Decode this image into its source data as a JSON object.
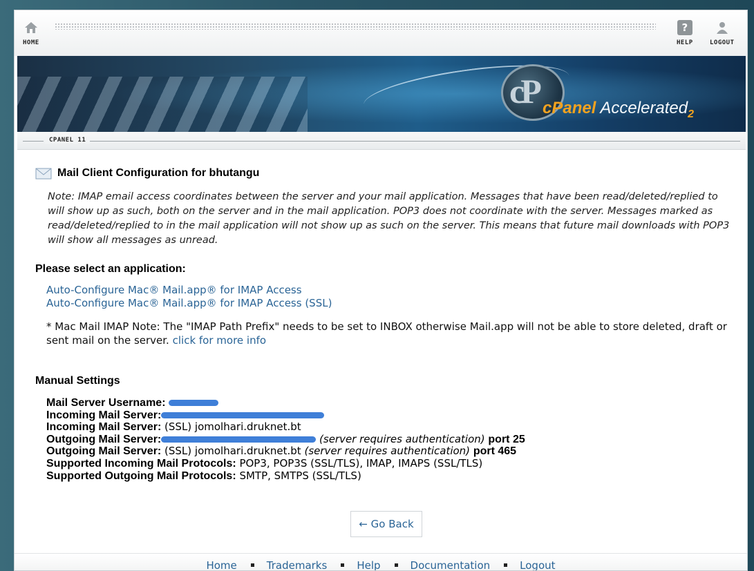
{
  "nav": {
    "home_label": "HOME",
    "help_label": "HELP",
    "logout_label": "LOGOUT"
  },
  "banner": {
    "logo_cpanel": "cPanel",
    "logo_accelerated": "Accelerated",
    "logo_version": "2"
  },
  "breadcrumb": {
    "label": "CPANEL 11"
  },
  "page": {
    "title": "Mail Client Configuration for bhutangu",
    "note": "Note: IMAP email access coordinates between the server and your mail application. Messages that have been read/deleted/replied to will show up as such, both on the server and in the mail application. POP3 does not coordinate with the server. Messages marked as read/deleted/replied to in the mail application will not show up as such on the server. This means that future mail downloads with POP3 will show all messages as unread."
  },
  "apps": {
    "heading": "Please select an application:",
    "links": [
      "Auto-Configure Mac® Mail.app® for IMAP Access",
      "Auto-Configure Mac® Mail.app® for IMAP Access (SSL)"
    ],
    "mac_note": "* Mac Mail IMAP Note: The \"IMAP Path Prefix\" needs to be set to INBOX otherwise Mail.app will not be able to store deleted, draft or sent mail on the server.",
    "more_info": "click for more info"
  },
  "manual": {
    "heading": "Manual Settings",
    "username_label": "Mail Server Username:",
    "incoming_label": "Incoming Mail Server:",
    "incoming_ssl_label": "Incoming Mail Server:",
    "incoming_ssl_value": "(SSL) jomolhari.druknet.bt",
    "outgoing_label": "Outgoing Mail Server:",
    "outgoing_auth_note": "(server requires authentication)",
    "outgoing_port": "port 25",
    "outgoing_ssl_label": "Outgoing Mail Server:",
    "outgoing_ssl_value": "(SSL) jomolhari.druknet.bt",
    "outgoing_ssl_auth_note": "(server requires authentication)",
    "outgoing_ssl_port": "port 465",
    "in_protocols_label": "Supported Incoming Mail Protocols:",
    "in_protocols_value": "POP3, POP3S (SSL/TLS), IMAP, IMAPS (SSL/TLS)",
    "out_protocols_label": "Supported Outgoing Mail Protocols:",
    "out_protocols_value": "SMTP, SMTPS (SSL/TLS)"
  },
  "go_back": "← Go Back",
  "footer": {
    "links": [
      "Home",
      "Trademarks",
      "Help",
      "Documentation",
      "Logout"
    ]
  },
  "colors": {
    "link": "#2a6496",
    "redaction": "#3f7fd8",
    "logo_orange": "#f2a21f"
  }
}
